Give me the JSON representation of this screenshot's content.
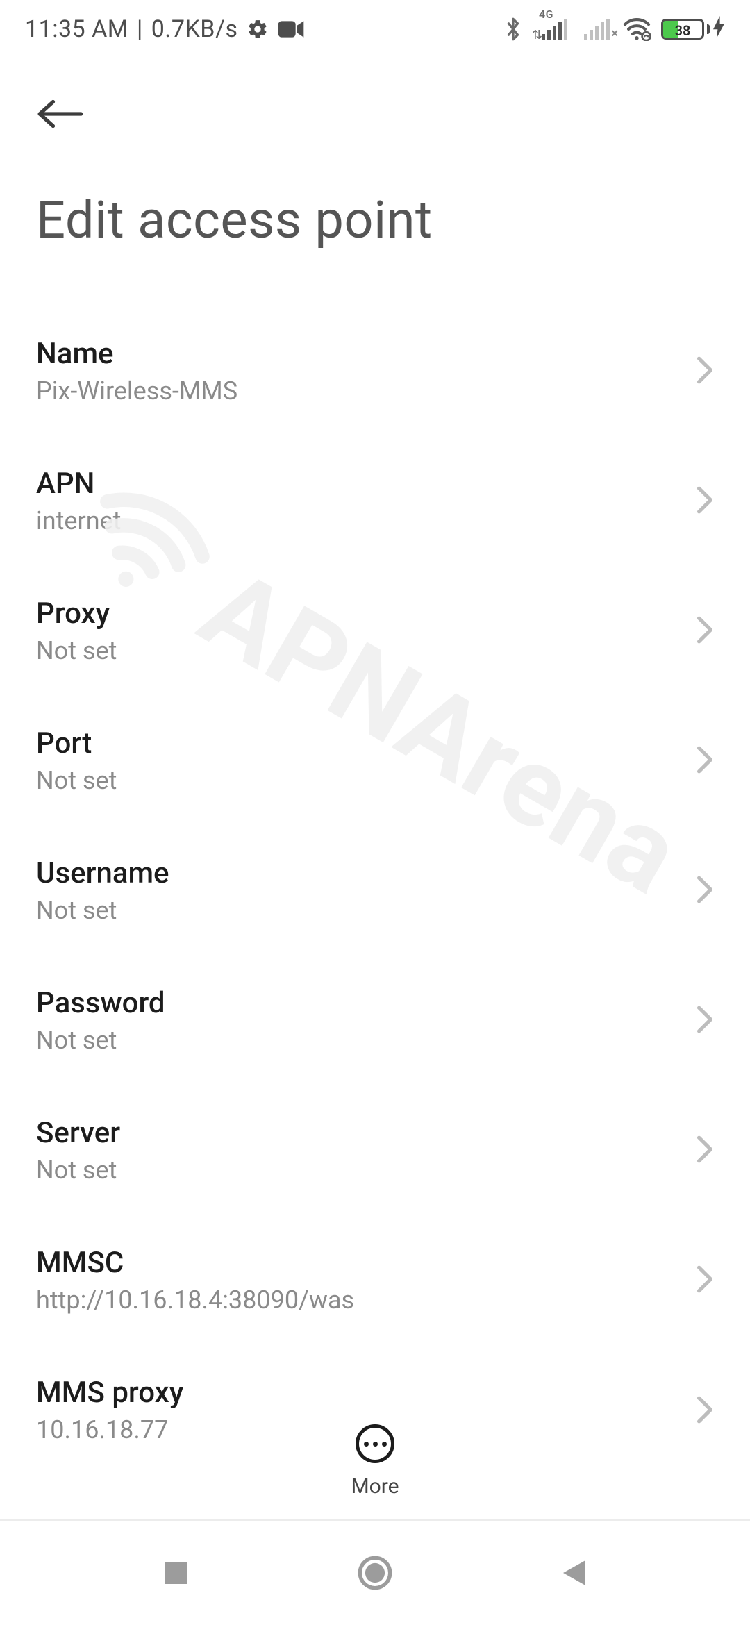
{
  "status": {
    "time": "11:35 AM",
    "data_rate": "0.7KB/s",
    "sim1_label": "4G",
    "battery_pct": "38"
  },
  "page_title": "Edit access point",
  "settings": [
    {
      "label": "Name",
      "value": "Pix-Wireless-MMS"
    },
    {
      "label": "APN",
      "value": "internet"
    },
    {
      "label": "Proxy",
      "value": "Not set"
    },
    {
      "label": "Port",
      "value": "Not set"
    },
    {
      "label": "Username",
      "value": "Not set"
    },
    {
      "label": "Password",
      "value": "Not set"
    },
    {
      "label": "Server",
      "value": "Not set"
    },
    {
      "label": "MMSC",
      "value": "http://10.16.18.4:38090/was"
    },
    {
      "label": "MMS proxy",
      "value": "10.16.18.77"
    }
  ],
  "action_bar": {
    "more_label": "More"
  },
  "watermark": "APNArena"
}
